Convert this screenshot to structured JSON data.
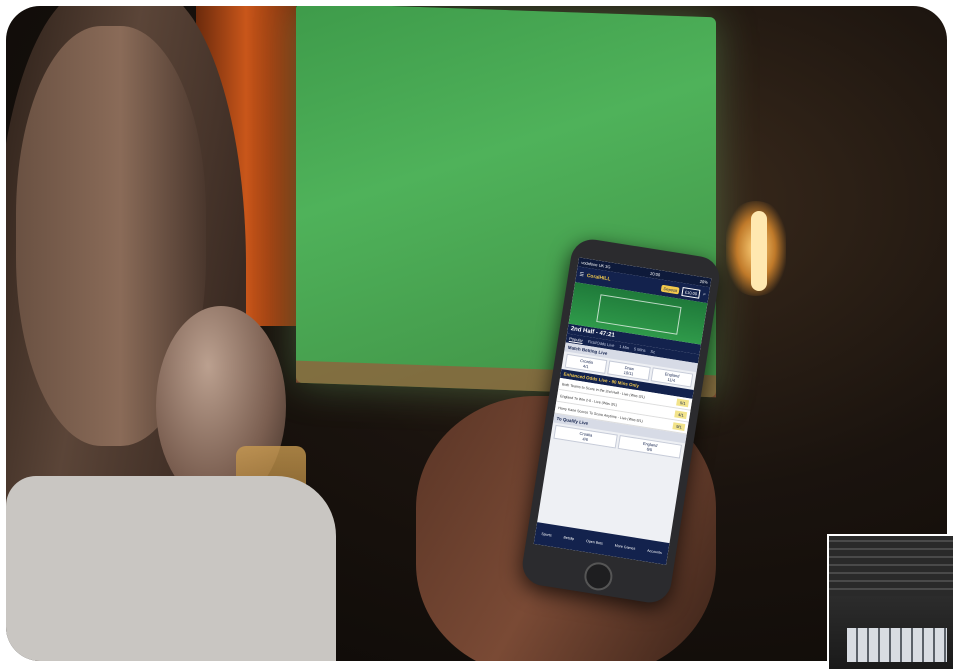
{
  "scene": {
    "description_label": "Person using a sports betting app on a phone in a bar while watching football on TV",
    "phone_app": {
      "status_bar": {
        "carrier": "vodafone UK 3G",
        "time": "20:00",
        "battery": "20%"
      },
      "app_bar": {
        "logo": "CoralHILL",
        "deposit_label": "Deposit",
        "balance": "£10.00"
      },
      "match_time": "2nd Half - 47:21",
      "tabs": [
        "Popular",
        "First/Odds Live",
        "1 Min",
        "5 Mins",
        "Sc"
      ],
      "sections": {
        "match_betting": {
          "title": "Match Betting Live",
          "odds": [
            {
              "label": "Croatia",
              "price": "4/1"
            },
            {
              "label": "Draw",
              "price": "10/11"
            },
            {
              "label": "England",
              "price": "11/4"
            }
          ]
        },
        "enhanced": {
          "title": "Enhanced Odds Live - 90 Mins Only",
          "rows": [
            {
              "text": "Both Teams to Score in the 2nd Half - Live (Was 3/1)",
              "price": "5/1"
            },
            {
              "text": "England To Win 2-0 - Live (Was 3/1)",
              "price": "4/1"
            },
            {
              "text": "Harry Kane Scores To Score Anytime - Live (Was 8/1)",
              "price": "9/1"
            }
          ]
        },
        "to_qualify": {
          "title": "To Qualify Live",
          "odds": [
            {
              "label": "Croatia",
              "price": "4/6"
            },
            {
              "label": "England",
              "price": "6/5"
            }
          ]
        }
      },
      "bottom_nav": [
        "Sports",
        "Betslip",
        "Open Bets",
        "More Games",
        "Accounts"
      ]
    }
  },
  "colors": {
    "app_navy": "#13224d",
    "app_gold": "#f2c94c",
    "pitch_green": "#2f9a4a"
  }
}
